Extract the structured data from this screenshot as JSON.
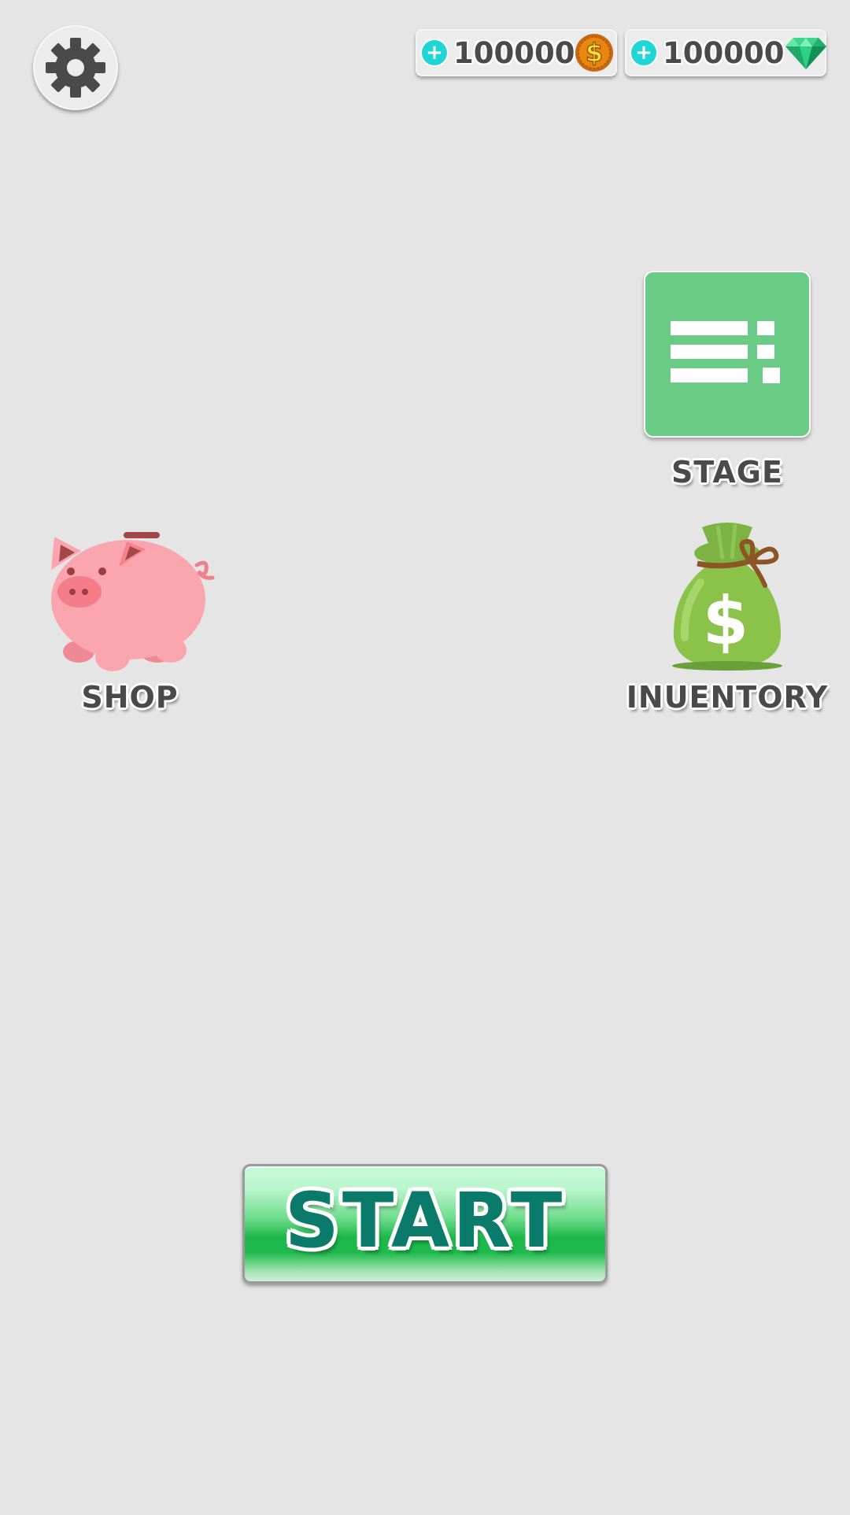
{
  "header": {
    "settings_icon": "gear-icon",
    "currencies": [
      {
        "name": "coins",
        "value": "100000",
        "icon": "dollar-coin-icon",
        "add_icon": "plus-icon"
      },
      {
        "name": "gems",
        "value": "100000",
        "icon": "green-gem-icon",
        "add_icon": "plus-icon"
      }
    ]
  },
  "menu": {
    "stage": {
      "label": "STAGE",
      "icon": "list-icon",
      "tile_color": "#6acb86"
    },
    "shop": {
      "label": "SHOP",
      "icon": "piggy-bank-icon"
    },
    "inventory": {
      "label": "INUENTORY",
      "icon": "money-bag-icon"
    }
  },
  "start": {
    "label": "START",
    "text_color": "#0a7a6a"
  },
  "colors": {
    "background": "#e5e5e5",
    "label_text": "#4a4a4a",
    "plus_button": "#1fd6d6",
    "start_green": "#1cb64a"
  }
}
